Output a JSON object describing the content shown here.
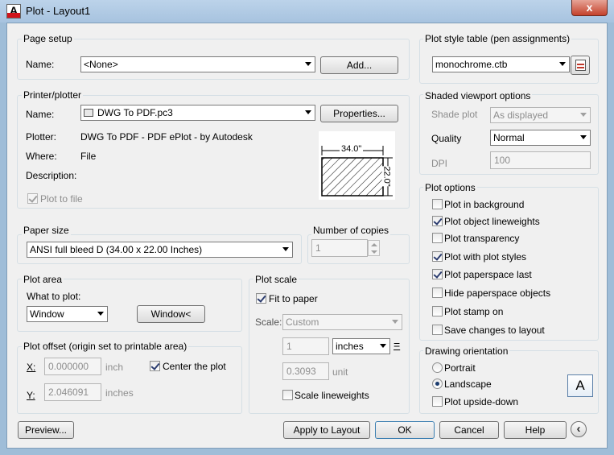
{
  "window": {
    "title": "Plot - Layout1",
    "close_glyph": "x",
    "app_letter": "A"
  },
  "page_setup": {
    "title": "Page setup",
    "name_label": "Name:",
    "name_value": "<None>",
    "add_button": "Add..."
  },
  "printer": {
    "title": "Printer/plotter",
    "name_label": "Name:",
    "name_value": "DWG To PDF.pc3",
    "properties_button": "Properties...",
    "plotter_label": "Plotter:",
    "plotter_value": "DWG To PDF - PDF ePlot - by Autodesk",
    "where_label": "Where:",
    "where_value": "File",
    "description_label": "Description:",
    "plot_to_file": "Plot to file",
    "preview_width": "34.0\"",
    "preview_height": "22.0\""
  },
  "paper_size": {
    "title": "Paper size",
    "value": "ANSI full bleed D (34.00 x 22.00 Inches)"
  },
  "copies": {
    "title": "Number of copies",
    "value": "1"
  },
  "plot_area": {
    "title": "Plot area",
    "what_label": "What to plot:",
    "what_value": "Window",
    "window_button": "Window<"
  },
  "plot_offset": {
    "title": "Plot offset (origin set to printable area)",
    "x_label": "X:",
    "x_value": "0.000000",
    "x_unit": "inch",
    "y_label": "Y:",
    "y_value": "2.046091",
    "y_unit": "inches",
    "center_label": "Center the plot"
  },
  "plot_scale": {
    "title": "Plot scale",
    "fit_label": "Fit to paper",
    "scale_label": "Scale:",
    "scale_value": "Custom",
    "value1": "1",
    "unit_value": "inches",
    "equals": "=",
    "value2": "0.3093",
    "unit2": "unit",
    "scale_lineweights": "Scale lineweights"
  },
  "plot_style": {
    "title": "Plot style table (pen assignments)",
    "value": "monochrome.ctb"
  },
  "shaded": {
    "title": "Shaded viewport options",
    "shade_label": "Shade plot",
    "shade_value": "As displayed",
    "quality_label": "Quality",
    "quality_value": "Normal",
    "dpi_label": "DPI",
    "dpi_value": "100"
  },
  "plot_options": {
    "title": "Plot options",
    "items": [
      {
        "label": "Plot in background",
        "checked": false
      },
      {
        "label": "Plot object lineweights",
        "checked": true
      },
      {
        "label": "Plot transparency",
        "checked": false
      },
      {
        "label": "Plot with plot styles",
        "checked": true
      },
      {
        "label": "Plot paperspace last",
        "checked": true
      },
      {
        "label": "Hide paperspace objects",
        "checked": false
      },
      {
        "label": "Plot stamp on",
        "checked": false
      },
      {
        "label": "Save changes to layout",
        "checked": false
      }
    ]
  },
  "orientation": {
    "title": "Drawing orientation",
    "portrait": "Portrait",
    "landscape": "Landscape",
    "upside_down": "Plot upside-down",
    "icon_letter": "A"
  },
  "footer": {
    "preview": "Preview...",
    "apply": "Apply to Layout",
    "ok": "OK",
    "cancel": "Cancel",
    "help": "Help",
    "collapse_glyph": "‹"
  }
}
